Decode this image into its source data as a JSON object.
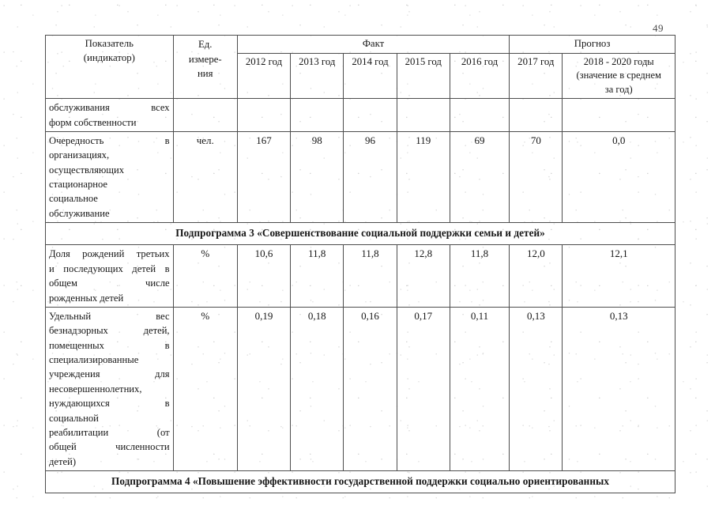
{
  "page": {
    "number": "49"
  },
  "table": {
    "header": {
      "indicator": "Показатель (индикатор)",
      "indicator_line1": "Показатель",
      "indicator_line2": "(индикатор)",
      "unit_line1": "Ед.",
      "unit_line2": "измере-",
      "unit_line3": "ния",
      "group_fact": "Факт",
      "group_forecast": "Прогноз",
      "years": [
        "2012 год",
        "2013 год",
        "2014 год",
        "2015 год",
        "2016 год",
        "2017 год"
      ],
      "last_col_line1": "2018 - 2020 годы",
      "last_col_line2": "(значение в среднем",
      "last_col_line3": "за год)"
    },
    "rows": [
      {
        "type": "data",
        "indicator_lines": [
          "обслуживания       всех",
          "форм собственности"
        ],
        "unit": "",
        "values": [
          "",
          "",
          "",
          "",
          "",
          "",
          ""
        ]
      },
      {
        "type": "data",
        "indicator_lines": [
          "Очередность              в",
          "организациях,",
          "осуществляющих",
          "стационарное",
          "социальное",
          "обслуживание"
        ],
        "unit": "чел.",
        "values": [
          "167",
          "98",
          "96",
          "119",
          "69",
          "70",
          "0,0"
        ]
      },
      {
        "type": "subprogram",
        "title": "Подпрограмма 3 «Совершенствование социальной поддержки семьи и детей»"
      },
      {
        "type": "data",
        "indicator_lines": [
          "Доля рождений третьих",
          "и последующих детей в",
          "общем               числе",
          "рожденных детей"
        ],
        "unit": "%",
        "values": [
          "10,6",
          "11,8",
          "11,8",
          "12,8",
          "11,8",
          "12,0",
          "12,1"
        ]
      },
      {
        "type": "data",
        "indicator_lines": [
          "Удельный             вес",
          "безнадзорных      детей,",
          "помещенных            в",
          "специализированные",
          "учреждения          для",
          "несовершеннолетних,",
          "нуждающихся          в",
          "социальной",
          "реабилитации       (от",
          "общей     численности",
          "детей)"
        ],
        "unit": "%",
        "values": [
          "0,19",
          "0,18",
          "0,16",
          "0,17",
          "0,11",
          "0,13",
          "0,13"
        ]
      },
      {
        "type": "subprogram",
        "title": "Подпрограмма 4 «Повышение эффективности государственной поддержки социально ориентированных"
      }
    ]
  }
}
